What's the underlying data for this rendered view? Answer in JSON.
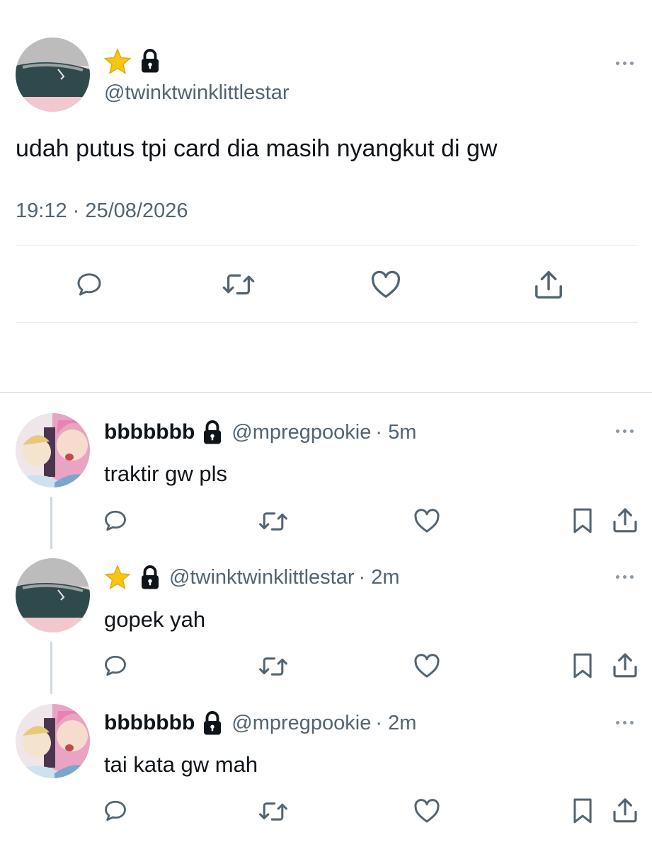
{
  "main_tweet": {
    "display_name_icons": [
      "star-emoji-icon",
      "lock-icon"
    ],
    "handle": "@twinktwinklittlestar",
    "text": "udah putus tpi card dia masih nyangkut di gw",
    "timestamp": "19:12 · 25/08/2026",
    "actions": [
      "reply-icon",
      "retweet-icon",
      "like-icon",
      "share-icon"
    ]
  },
  "replies": [
    {
      "display_name": "bbbbbbb",
      "handle": "@mpregpookie",
      "time": "· 5m",
      "text": "traktir gw pls",
      "protected": true
    },
    {
      "display_name": "",
      "display_name_icons": [
        "star-emoji-icon",
        "lock-icon"
      ],
      "handle": "@twinktwinklittlestar",
      "time": "· 2m",
      "text": "gopek yah",
      "protected": true
    },
    {
      "display_name": "bbbbbbb",
      "handle": "@mpregpookie",
      "time": "· 2m",
      "text": "tai kata gw mah",
      "protected": true
    }
  ],
  "colors": {
    "text": "#0f1419",
    "muted": "#536471",
    "divider": "#e1e8ed",
    "thread_line": "#cfd9de",
    "star": "#f7c614"
  }
}
